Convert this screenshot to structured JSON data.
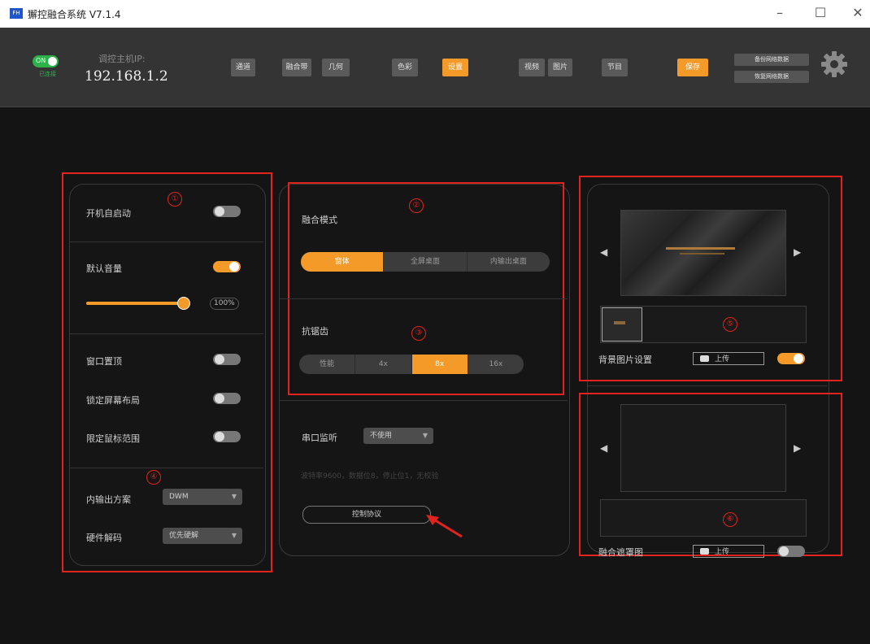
{
  "window": {
    "icon_text": "FH",
    "title": "獬控融合系统 V7.1.4",
    "minimize_icon": "–",
    "maximize_icon": "☐",
    "close_icon": "✕"
  },
  "topbar": {
    "power_toggle_text": "ON",
    "power_status": "已连接",
    "host_label": "调控主机IP:",
    "host_ip": "192.168.1.2",
    "buttons": [
      "通道",
      "融合带",
      "几何",
      "色彩",
      "设置",
      "视频",
      "图片",
      "节目",
      "保存"
    ],
    "small_buttons": [
      "备份网络数据",
      "恢复网络数据"
    ],
    "accent_color": "#f39a28"
  },
  "panel1": {
    "marker1": "①",
    "marker4": "④",
    "autostart_label": "开机自启动",
    "volume_label": "默认音量",
    "volume_value": "100%",
    "topmost_label": "窗口置顶",
    "lock_layout_label": "锁定屏幕布局",
    "limit_mouse_label": "限定鼠标范围",
    "output_scheme_label": "内输出方案",
    "output_scheme_value": "DWM",
    "hw_decode_label": "硬件解码",
    "hw_decode_value": "优先硬解"
  },
  "panel2": {
    "marker2": "②",
    "marker3": "③",
    "blend_mode_label": "融合模式",
    "blend_modes": [
      "窗体",
      "全屏桌面",
      "内输出桌面"
    ],
    "antialias_label": "抗锯齿",
    "antialias_options": [
      "性能",
      "4x",
      "8x",
      "16x"
    ],
    "serial_label": "串口监听",
    "serial_value": "不使用",
    "serial_hint": "波特率9600，数据位8，停止位1，无校验",
    "protocol_button": "控制协议"
  },
  "panel3": {
    "marker5": "⑤",
    "marker6": "⑥",
    "bg_image_label": "背景图片设置",
    "upload_label": "上传",
    "mask_label": "融合遮罩图",
    "upload_label_2": "上传"
  }
}
